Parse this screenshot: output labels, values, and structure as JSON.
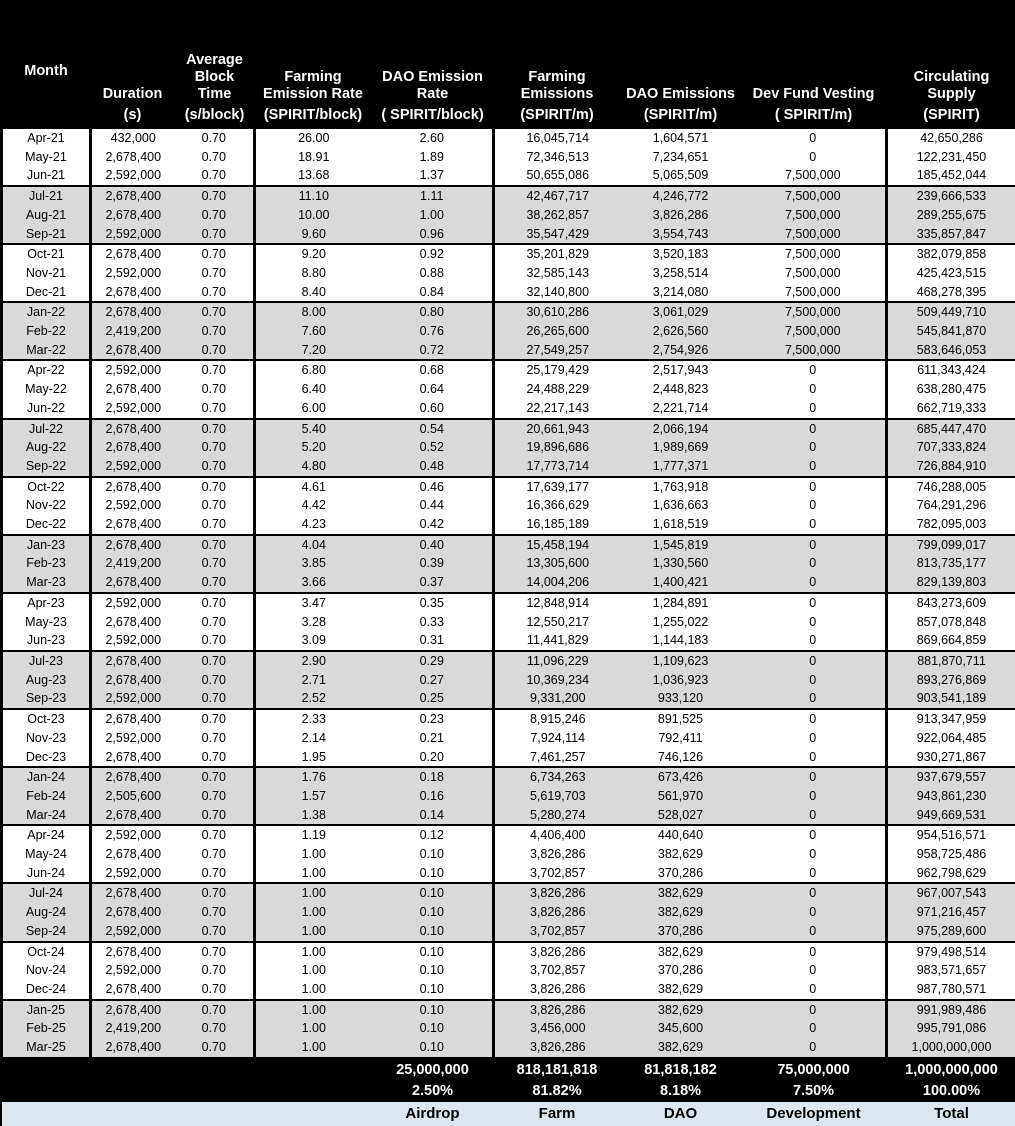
{
  "table": {
    "headers": [
      {
        "title": "Month",
        "unit": ""
      },
      {
        "title": "Duration",
        "unit": "(s)"
      },
      {
        "title": "Average Block Time",
        "unit": "(s/block)"
      },
      {
        "title": "Farming Emission Rate",
        "unit": "(SPIRIT/block)"
      },
      {
        "title": "DAO Emission Rate",
        "unit": "( SPIRIT/block)"
      },
      {
        "title": "Farming Emissions",
        "unit": "(SPIRIT/m)"
      },
      {
        "title": "DAO Emissions",
        "unit": "(SPIRIT/m)"
      },
      {
        "title": "Dev Fund Vesting",
        "unit": "( SPIRIT/m)"
      },
      {
        "title": "Circulating Supply",
        "unit": "(SPIRIT)"
      }
    ],
    "rows": [
      [
        "Apr-21",
        "432,000",
        "0.70",
        "26.00",
        "2.60",
        "16,045,714",
        "1,604,571",
        "0",
        "42,650,286"
      ],
      [
        "May-21",
        "2,678,400",
        "0.70",
        "18.91",
        "1.89",
        "72,346,513",
        "7,234,651",
        "0",
        "122,231,450"
      ],
      [
        "Jun-21",
        "2,592,000",
        "0.70",
        "13.68",
        "1.37",
        "50,655,086",
        "5,065,509",
        "7,500,000",
        "185,452,044"
      ],
      [
        "Jul-21",
        "2,678,400",
        "0.70",
        "11.10",
        "1.11",
        "42,467,717",
        "4,246,772",
        "7,500,000",
        "239,666,533"
      ],
      [
        "Aug-21",
        "2,678,400",
        "0.70",
        "10.00",
        "1.00",
        "38,262,857",
        "3,826,286",
        "7,500,000",
        "289,255,675"
      ],
      [
        "Sep-21",
        "2,592,000",
        "0.70",
        "9.60",
        "0.96",
        "35,547,429",
        "3,554,743",
        "7,500,000",
        "335,857,847"
      ],
      [
        "Oct-21",
        "2,678,400",
        "0.70",
        "9.20",
        "0.92",
        "35,201,829",
        "3,520,183",
        "7,500,000",
        "382,079,858"
      ],
      [
        "Nov-21",
        "2,592,000",
        "0.70",
        "8.80",
        "0.88",
        "32,585,143",
        "3,258,514",
        "7,500,000",
        "425,423,515"
      ],
      [
        "Dec-21",
        "2,678,400",
        "0.70",
        "8.40",
        "0.84",
        "32,140,800",
        "3,214,080",
        "7,500,000",
        "468,278,395"
      ],
      [
        "Jan-22",
        "2,678,400",
        "0.70",
        "8.00",
        "0.80",
        "30,610,286",
        "3,061,029",
        "7,500,000",
        "509,449,710"
      ],
      [
        "Feb-22",
        "2,419,200",
        "0.70",
        "7.60",
        "0.76",
        "26,265,600",
        "2,626,560",
        "7,500,000",
        "545,841,870"
      ],
      [
        "Mar-22",
        "2,678,400",
        "0.70",
        "7.20",
        "0.72",
        "27,549,257",
        "2,754,926",
        "7,500,000",
        "583,646,053"
      ],
      [
        "Apr-22",
        "2,592,000",
        "0.70",
        "6.80",
        "0.68",
        "25,179,429",
        "2,517,943",
        "0",
        "611,343,424"
      ],
      [
        "May-22",
        "2,678,400",
        "0.70",
        "6.40",
        "0.64",
        "24,488,229",
        "2,448,823",
        "0",
        "638,280,475"
      ],
      [
        "Jun-22",
        "2,592,000",
        "0.70",
        "6.00",
        "0.60",
        "22,217,143",
        "2,221,714",
        "0",
        "662,719,333"
      ],
      [
        "Jul-22",
        "2,678,400",
        "0.70",
        "5.40",
        "0.54",
        "20,661,943",
        "2,066,194",
        "0",
        "685,447,470"
      ],
      [
        "Aug-22",
        "2,678,400",
        "0.70",
        "5.20",
        "0.52",
        "19,896,686",
        "1,989,669",
        "0",
        "707,333,824"
      ],
      [
        "Sep-22",
        "2,592,000",
        "0.70",
        "4.80",
        "0.48",
        "17,773,714",
        "1,777,371",
        "0",
        "726,884,910"
      ],
      [
        "Oct-22",
        "2,678,400",
        "0.70",
        "4.61",
        "0.46",
        "17,639,177",
        "1,763,918",
        "0",
        "746,288,005"
      ],
      [
        "Nov-22",
        "2,592,000",
        "0.70",
        "4.42",
        "0.44",
        "16,366,629",
        "1,636,663",
        "0",
        "764,291,296"
      ],
      [
        "Dec-22",
        "2,678,400",
        "0.70",
        "4.23",
        "0.42",
        "16,185,189",
        "1,618,519",
        "0",
        "782,095,003"
      ],
      [
        "Jan-23",
        "2,678,400",
        "0.70",
        "4.04",
        "0.40",
        "15,458,194",
        "1,545,819",
        "0",
        "799,099,017"
      ],
      [
        "Feb-23",
        "2,419,200",
        "0.70",
        "3.85",
        "0.39",
        "13,305,600",
        "1,330,560",
        "0",
        "813,735,177"
      ],
      [
        "Mar-23",
        "2,678,400",
        "0.70",
        "3.66",
        "0.37",
        "14,004,206",
        "1,400,421",
        "0",
        "829,139,803"
      ],
      [
        "Apr-23",
        "2,592,000",
        "0.70",
        "3.47",
        "0.35",
        "12,848,914",
        "1,284,891",
        "0",
        "843,273,609"
      ],
      [
        "May-23",
        "2,678,400",
        "0.70",
        "3.28",
        "0.33",
        "12,550,217",
        "1,255,022",
        "0",
        "857,078,848"
      ],
      [
        "Jun-23",
        "2,592,000",
        "0.70",
        "3.09",
        "0.31",
        "11,441,829",
        "1,144,183",
        "0",
        "869,664,859"
      ],
      [
        "Jul-23",
        "2,678,400",
        "0.70",
        "2.90",
        "0.29",
        "11,096,229",
        "1,109,623",
        "0",
        "881,870,711"
      ],
      [
        "Aug-23",
        "2,678,400",
        "0.70",
        "2.71",
        "0.27",
        "10,369,234",
        "1,036,923",
        "0",
        "893,276,869"
      ],
      [
        "Sep-23",
        "2,592,000",
        "0.70",
        "2.52",
        "0.25",
        "9,331,200",
        "933,120",
        "0",
        "903,541,189"
      ],
      [
        "Oct-23",
        "2,678,400",
        "0.70",
        "2.33",
        "0.23",
        "8,915,246",
        "891,525",
        "0",
        "913,347,959"
      ],
      [
        "Nov-23",
        "2,592,000",
        "0.70",
        "2.14",
        "0.21",
        "7,924,114",
        "792,411",
        "0",
        "922,064,485"
      ],
      [
        "Dec-23",
        "2,678,400",
        "0.70",
        "1.95",
        "0.20",
        "7,461,257",
        "746,126",
        "0",
        "930,271,867"
      ],
      [
        "Jan-24",
        "2,678,400",
        "0.70",
        "1.76",
        "0.18",
        "6,734,263",
        "673,426",
        "0",
        "937,679,557"
      ],
      [
        "Feb-24",
        "2,505,600",
        "0.70",
        "1.57",
        "0.16",
        "5,619,703",
        "561,970",
        "0",
        "943,861,230"
      ],
      [
        "Mar-24",
        "2,678,400",
        "0.70",
        "1.38",
        "0.14",
        "5,280,274",
        "528,027",
        "0",
        "949,669,531"
      ],
      [
        "Apr-24",
        "2,592,000",
        "0.70",
        "1.19",
        "0.12",
        "4,406,400",
        "440,640",
        "0",
        "954,516,571"
      ],
      [
        "May-24",
        "2,678,400",
        "0.70",
        "1.00",
        "0.10",
        "3,826,286",
        "382,629",
        "0",
        "958,725,486"
      ],
      [
        "Jun-24",
        "2,592,000",
        "0.70",
        "1.00",
        "0.10",
        "3,702,857",
        "370,286",
        "0",
        "962,798,629"
      ],
      [
        "Jul-24",
        "2,678,400",
        "0.70",
        "1.00",
        "0.10",
        "3,826,286",
        "382,629",
        "0",
        "967,007,543"
      ],
      [
        "Aug-24",
        "2,678,400",
        "0.70",
        "1.00",
        "0.10",
        "3,826,286",
        "382,629",
        "0",
        "971,216,457"
      ],
      [
        "Sep-24",
        "2,592,000",
        "0.70",
        "1.00",
        "0.10",
        "3,702,857",
        "370,286",
        "0",
        "975,289,600"
      ],
      [
        "Oct-24",
        "2,678,400",
        "0.70",
        "1.00",
        "0.10",
        "3,826,286",
        "382,629",
        "0",
        "979,498,514"
      ],
      [
        "Nov-24",
        "2,592,000",
        "0.70",
        "1.00",
        "0.10",
        "3,702,857",
        "370,286",
        "0",
        "983,571,657"
      ],
      [
        "Dec-24",
        "2,678,400",
        "0.70",
        "1.00",
        "0.10",
        "3,826,286",
        "382,629",
        "0",
        "987,780,571"
      ],
      [
        "Jan-25",
        "2,678,400",
        "0.70",
        "1.00",
        "0.10",
        "3,826,286",
        "382,629",
        "0",
        "991,989,486"
      ],
      [
        "Feb-25",
        "2,419,200",
        "0.70",
        "1.00",
        "0.10",
        "3,456,000",
        "345,600",
        "0",
        "995,791,086"
      ],
      [
        "Mar-25",
        "2,678,400",
        "0.70",
        "1.00",
        "0.10",
        "3,826,286",
        "382,629",
        "0",
        "1,000,000,000"
      ]
    ],
    "footer": {
      "totals": [
        "",
        "",
        "",
        "25,000,000",
        "818,181,818",
        "81,818,182",
        "75,000,000",
        "1,000,000,000"
      ],
      "percents": [
        "",
        "",
        "",
        "2.50%",
        "81.82%",
        "8.18%",
        "7.50%",
        "100.00%"
      ],
      "labels": [
        "",
        "",
        "",
        "Airdrop",
        "Farm",
        "DAO",
        "Development",
        "Total"
      ]
    }
  },
  "colors": {
    "background": "#000000",
    "band_light": "#ffffff",
    "band_dark": "#d9d9d9",
    "footer_label_bg": "#dce6f1",
    "header_text": "#ffffff"
  }
}
